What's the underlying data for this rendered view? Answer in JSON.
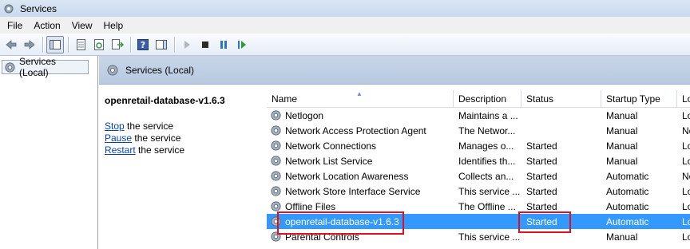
{
  "window": {
    "title": "Services"
  },
  "menu": {
    "items": [
      "File",
      "Action",
      "View",
      "Help"
    ]
  },
  "toolbar": {
    "buttons": [
      "back-icon",
      "forward-icon",
      "show-hide-console-tree-icon",
      "properties-icon",
      "refresh-icon",
      "export-list-icon",
      "help-icon",
      "show-hide-action-pane-icon",
      "start-service-icon",
      "stop-service-icon",
      "pause-service-icon",
      "restart-service-icon"
    ]
  },
  "tree": {
    "root_label": "Services (Local)"
  },
  "main": {
    "header": "Services (Local)"
  },
  "extended": {
    "service_name": "openretail-database-v1.6.3",
    "actions": [
      {
        "link": "Stop",
        "rest": " the service"
      },
      {
        "link": "Pause",
        "rest": " the service"
      },
      {
        "link": "Restart",
        "rest": " the service"
      }
    ]
  },
  "list": {
    "columns": [
      "Name",
      "Description",
      "Status",
      "Startup Type",
      "Lo"
    ],
    "rows": [
      {
        "name": "Netlogon",
        "description": "Maintains a ...",
        "status": "",
        "startup": "Manual",
        "logon": "Lo"
      },
      {
        "name": "Network Access Protection Agent",
        "description": "The Networ...",
        "status": "",
        "startup": "Manual",
        "logon": "Ne"
      },
      {
        "name": "Network Connections",
        "description": "Manages o...",
        "status": "Started",
        "startup": "Manual",
        "logon": "Lo"
      },
      {
        "name": "Network List Service",
        "description": "Identifies th...",
        "status": "Started",
        "startup": "Manual",
        "logon": "Lo"
      },
      {
        "name": "Network Location Awareness",
        "description": "Collects an...",
        "status": "Started",
        "startup": "Automatic",
        "logon": "Ne"
      },
      {
        "name": "Network Store Interface Service",
        "description": "This service ...",
        "status": "Started",
        "startup": "Automatic",
        "logon": "Lo"
      },
      {
        "name": "Offline Files",
        "description": "The Offline ...",
        "status": "Started",
        "startup": "Automatic",
        "logon": "Lo"
      },
      {
        "name": "openretail-database-v1.6.3",
        "description": "",
        "status": "Started",
        "startup": "Automatic",
        "logon": "Lo",
        "selected": true
      },
      {
        "name": "Parental Controls",
        "description": "This service ...",
        "status": "",
        "startup": "Manual",
        "logon": "Lo"
      }
    ]
  },
  "colors": {
    "selection": "#3399ff",
    "highlight_box": "#e01020",
    "link": "#0645ad"
  }
}
